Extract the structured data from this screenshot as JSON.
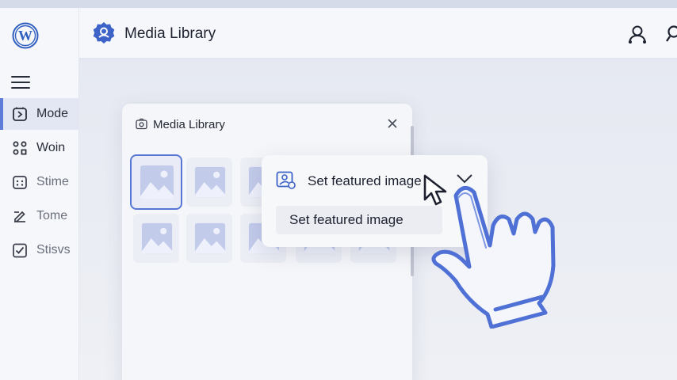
{
  "header": {
    "title": "Media Library"
  },
  "sidebar": {
    "items": [
      {
        "label": "Mode"
      },
      {
        "label": "Woin"
      },
      {
        "label": "Stime"
      },
      {
        "label": "Tome"
      },
      {
        "label": "Stisvs"
      }
    ]
  },
  "modal": {
    "title": "Media Library",
    "thumbnail_count": 10
  },
  "dropdown": {
    "selected_label": "Set featured image",
    "options": [
      "Set featured image"
    ]
  },
  "colors": {
    "accent": "#5677d4",
    "background": "#dde2ee"
  }
}
